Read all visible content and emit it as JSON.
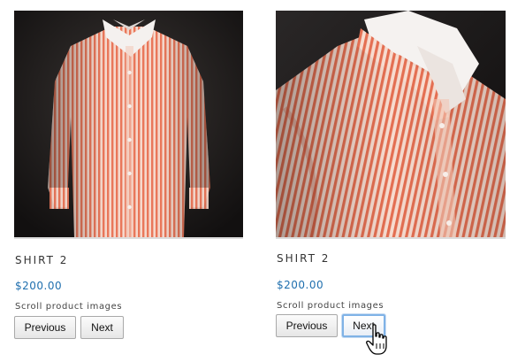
{
  "products": [
    {
      "image_icon": "shirt-front-photo",
      "name": "SHIRT 2",
      "price": "$200.00",
      "scroll_label": "Scroll product images",
      "prev_label": "Previous",
      "next_label": "Next"
    },
    {
      "image_icon": "shirt-closeup-photo",
      "name": "SHIRT 2",
      "price": "$200.00",
      "scroll_label": "Scroll product images",
      "prev_label": "Previous",
      "next_label": "Next"
    }
  ],
  "cursor": "hand-pointer-icon",
  "colors": {
    "price": "#1f6fae",
    "image_background": "#1c1a1a",
    "shirt_stripe": "#e9775a",
    "focus_ring": "#7fb2e6"
  }
}
